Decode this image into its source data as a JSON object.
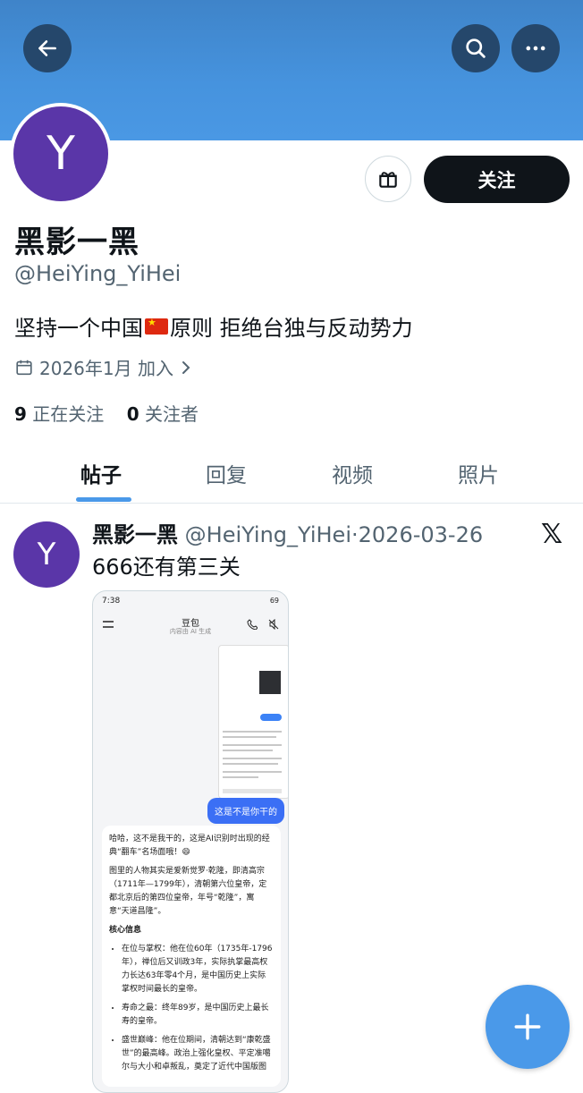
{
  "header": {
    "back_icon": "arrow-left-icon",
    "search_icon": "search-icon",
    "more_icon": "more-horizontal-icon"
  },
  "profile": {
    "avatar_letter": "Y",
    "avatar_color": "#5a36a8",
    "gift_icon": "gift-icon",
    "follow_label": "关注",
    "display_name": "黑影一黑",
    "handle": "@HeiYing_YiHei",
    "bio_part1": "坚持一个中国",
    "bio_flag_icon": "china-flag-icon",
    "bio_part2": "原则 拒绝台独与反动势力",
    "joined": "2026年1月 加入",
    "following_count": "9",
    "following_label": "正在关注",
    "followers_count": "0",
    "followers_label": "关注者"
  },
  "tabs": [
    {
      "label": "帖子",
      "active": true
    },
    {
      "label": "回复",
      "active": false
    },
    {
      "label": "视频",
      "active": false
    },
    {
      "label": "照片",
      "active": false
    }
  ],
  "post": {
    "avatar_letter": "Y",
    "author": "黑影一黑",
    "handle": "@HeiYing_YiHei",
    "separator": "·",
    "date": "2026-03-26",
    "source_icon": "x-logo-icon",
    "text": "666还有第三关",
    "screenshot": {
      "status_time": "7:38",
      "status_battery": "69",
      "app_title": "豆包",
      "app_subtitle": "内容由 AI 生成",
      "user_bubble": "这是不是你干的",
      "reply_p1": "哈哈，这不是我干的，这是AI识别时出现的经典“翻车”名场面哦！😄",
      "reply_p2": "图里的人物其实是爱新觉罗·乾隆，即清高宗（1711年—1799年），清朝第六位皇帝，定都北京后的第四位皇帝，年号“乾隆”，寓意“天道昌隆”。",
      "reply_h": "核心信息",
      "reply_li1": "在位与掌权：他在位60年（1735年-1796年），禅位后又训政3年，实际执掌最高权力长达63年零4个月，是中国历史上实际掌权时间最长的皇帝。",
      "reply_li2": "寿命之最：终年89岁，是中国历史上最长寿的皇帝。",
      "reply_li3": "盛世巅峰：他在位期间，清朝达到“康乾盛世”的最高峰。政治上强化皇权、平定准噶尔与大小和卓叛乱，奠定了近代中国版图"
    }
  },
  "fab": {
    "icon": "plus-icon"
  },
  "colors": {
    "accent": "#4a99e9",
    "banner": "#4693de",
    "follow_button": "#0f1419",
    "header_button": "#25476b"
  }
}
